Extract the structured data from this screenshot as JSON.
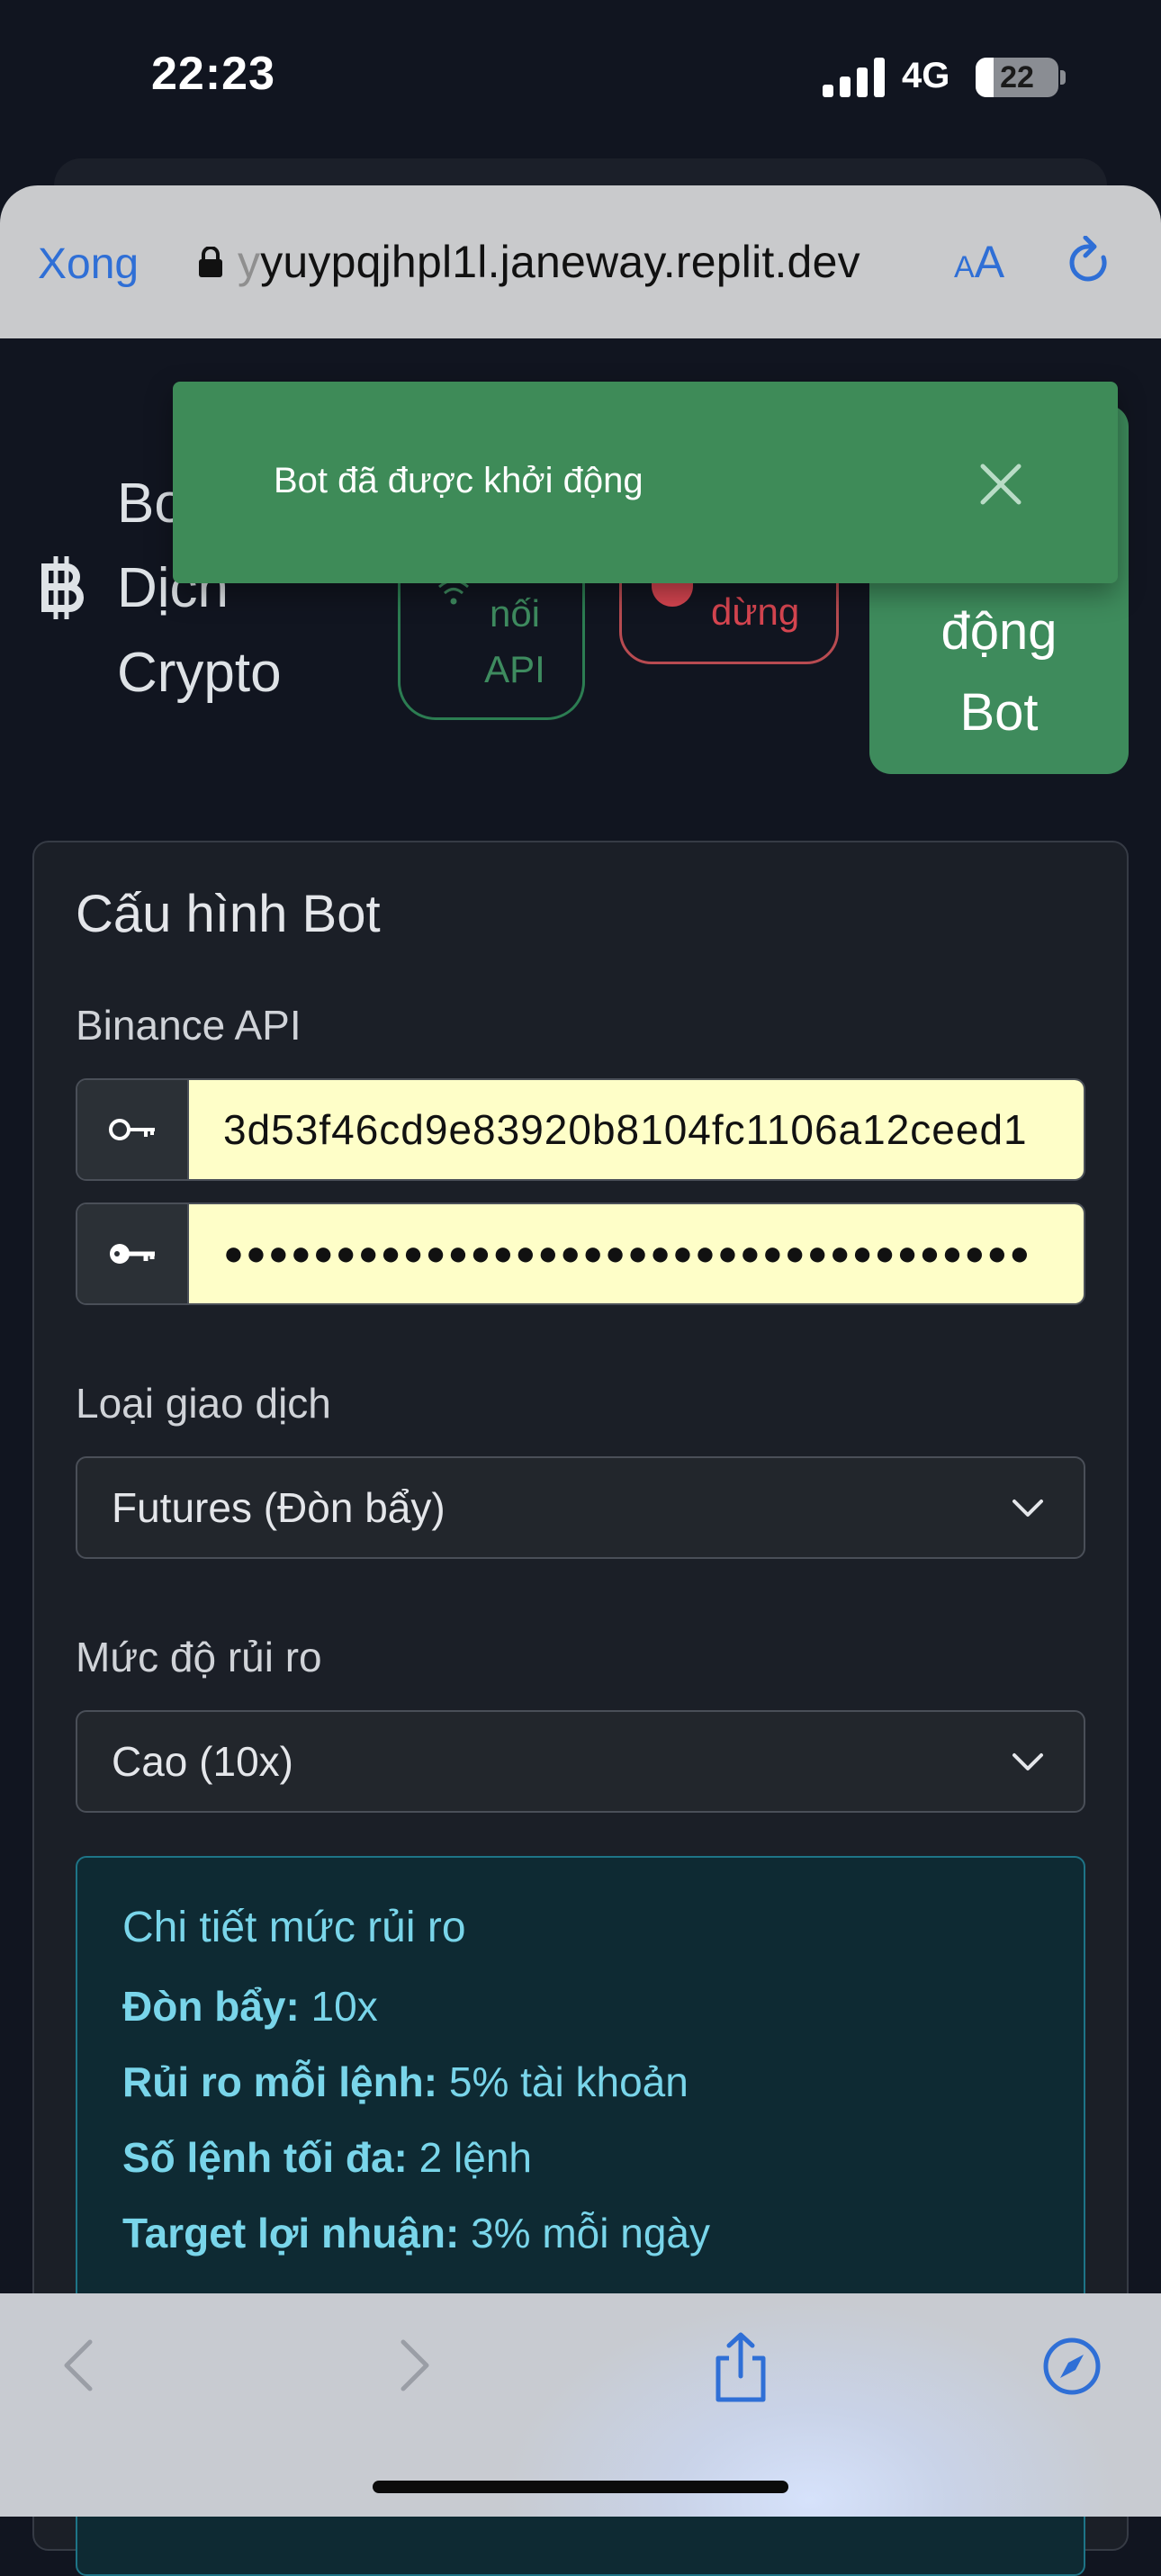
{
  "status_bar": {
    "time": "22:23",
    "network": "4G",
    "battery": "22",
    "battery_level_percent": 22
  },
  "browser": {
    "done_label": "Xong",
    "url_faded": "y",
    "url": "yuypqjhpl1l.janeway.replit.dev",
    "text_size_small": "A",
    "text_size_big": "A"
  },
  "header": {
    "brand_line1": "Bo",
    "brand_line2": "Dịch",
    "brand_line3": "Crypto",
    "connection_line1": "nối",
    "connection_line2": "API",
    "stopped_text": "dừng",
    "start_line1": "động",
    "start_line2": "Bot"
  },
  "toast": {
    "message": "Bot đã được khởi động"
  },
  "config": {
    "title": "Cấu hình Bot",
    "api_label": "Binance API",
    "api_key_value": "3d53f46cd9e83920b8104fc1106a12ceed1",
    "api_secret_value": "●●●●●●●●●●●●●●●●●●●●●●●●●●●●●●●●●●●●",
    "type_label": "Loại giao dịch",
    "type_selected": "Futures (Đòn bẩy)",
    "risk_label": "Mức độ rủi ro",
    "risk_selected": "Cao (10x)"
  },
  "risk_details": {
    "title": "Chi tiết mức rủi ro",
    "leverage_label": "Đòn bẩy:",
    "leverage_value": " 10x",
    "risk_per_order_label": "Rủi ro mỗi lệnh:",
    "risk_per_order_value": " 5% tài khoản",
    "max_orders_label": "Số lệnh tối đa:",
    "max_orders_value": " 2 lệnh",
    "profit_target_label": "Target lợi nhuận:",
    "profit_target_value": " 3% mỗi ngày"
  },
  "colors": {
    "page_bg": "#111520",
    "success": "#3e8b5c",
    "danger": "#d64550",
    "info": "#79d5ea",
    "link_blue": "#2f6fd6"
  },
  "icons": {
    "brand": "bitcoin-icon",
    "connection": "wifi-icon",
    "api_key": "key-icon",
    "api_secret": "key-icon",
    "select": "chevron-down-icon",
    "toolbar": [
      "back-icon",
      "forward-icon",
      "share-icon",
      "compass-icon"
    ]
  }
}
